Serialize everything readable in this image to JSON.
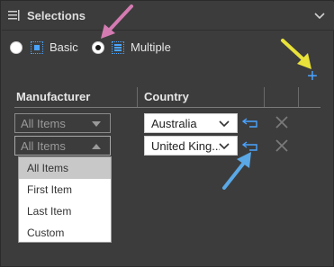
{
  "panel": {
    "title": "Selections"
  },
  "modes": {
    "basic_label": "Basic",
    "multiple_label": "Multiple",
    "selected": "Multiple"
  },
  "table": {
    "columns": [
      "Manufacturer",
      "Country"
    ],
    "rows": [
      {
        "manufacturer": "All Items",
        "country": "Australia"
      },
      {
        "manufacturer": "All Items",
        "country": "United King..."
      }
    ]
  },
  "dropdown": {
    "options": [
      "All Items",
      "First Item",
      "Last Item",
      "Custom"
    ],
    "highlighted": "All Items"
  },
  "icons": {
    "panel_menu": "hamburger-icon",
    "collapse": "chevron-down-icon",
    "add": "plus-icon",
    "reset": "undo-arrow-icon",
    "clear": "close-x-icon"
  },
  "colors": {
    "background": "#3c3c3c",
    "accent": "#4aa3ff",
    "annotation_pink": "#d47bb2",
    "annotation_yellow": "#e8e23a",
    "annotation_blue": "#5aa8e6"
  }
}
